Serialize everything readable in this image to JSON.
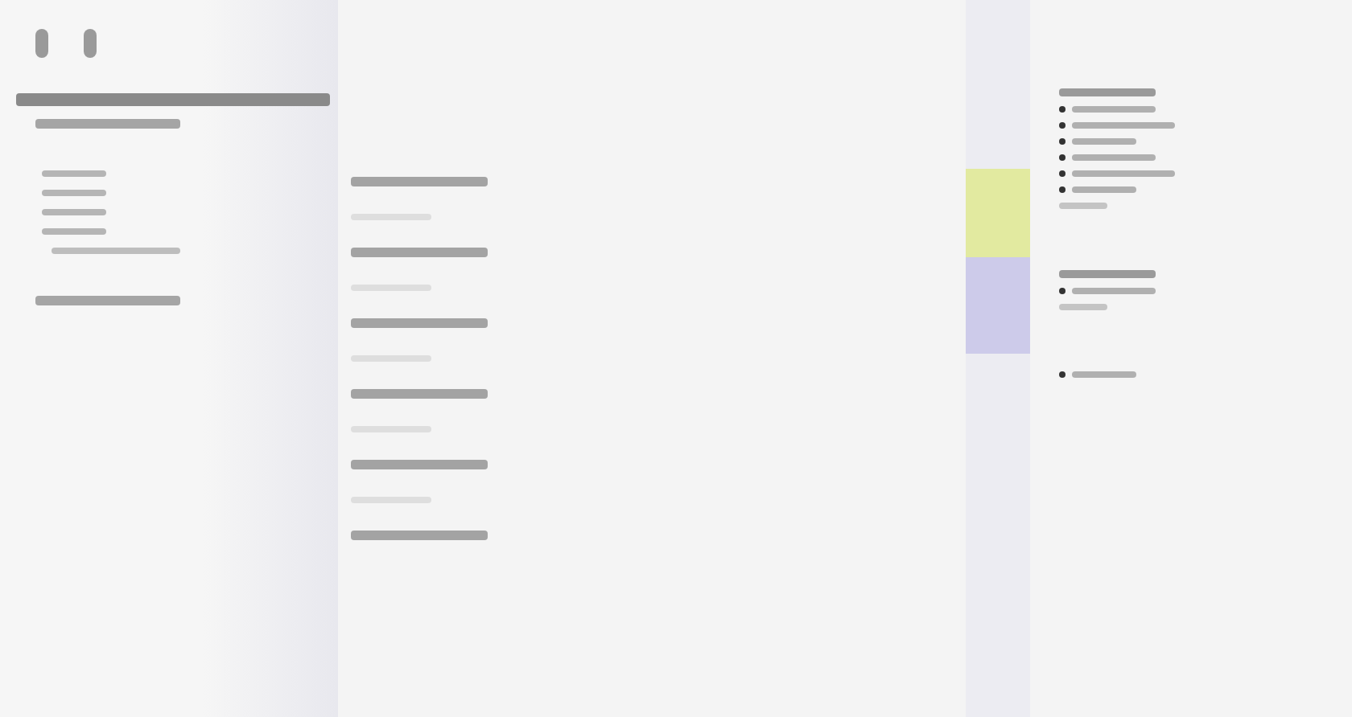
{
  "sidebar": {
    "header_icons": [
      {
        "kind": "dot"
      },
      {
        "kind": "dot"
      }
    ],
    "lines": [
      {
        "kind": "rule"
      },
      {
        "kind": "heading"
      },
      {
        "kind": "gap"
      },
      {
        "kind": "item"
      },
      {
        "kind": "item"
      },
      {
        "kind": "item"
      },
      {
        "kind": "item"
      },
      {
        "kind": "subitem"
      },
      {
        "kind": "gap"
      },
      {
        "kind": "heading"
      }
    ]
  },
  "middle": {
    "entries": [
      {
        "kind": "heading"
      },
      {
        "kind": "sub"
      },
      {
        "kind": "heading"
      },
      {
        "kind": "sub"
      },
      {
        "kind": "heading"
      },
      {
        "kind": "sub"
      },
      {
        "kind": "heading"
      },
      {
        "kind": "sub"
      },
      {
        "kind": "heading"
      },
      {
        "kind": "sub"
      },
      {
        "kind": "heading"
      }
    ]
  },
  "marker_column": {
    "bands": [
      {
        "color": "#e2eaa0"
      },
      {
        "color": "#cdcbea"
      }
    ]
  },
  "right_panel": {
    "groups": [
      {
        "items": [
          {
            "kind": "title"
          },
          {
            "kind": "bullet"
          },
          {
            "kind": "bullet"
          },
          {
            "kind": "bullet"
          },
          {
            "kind": "bullet"
          },
          {
            "kind": "bullet"
          },
          {
            "kind": "bullet"
          },
          {
            "kind": "plain"
          }
        ]
      },
      {
        "items": [
          {
            "kind": "title"
          },
          {
            "kind": "bullet"
          },
          {
            "kind": "plain"
          }
        ]
      },
      {
        "items": [
          {
            "kind": "bullet"
          }
        ]
      }
    ]
  }
}
